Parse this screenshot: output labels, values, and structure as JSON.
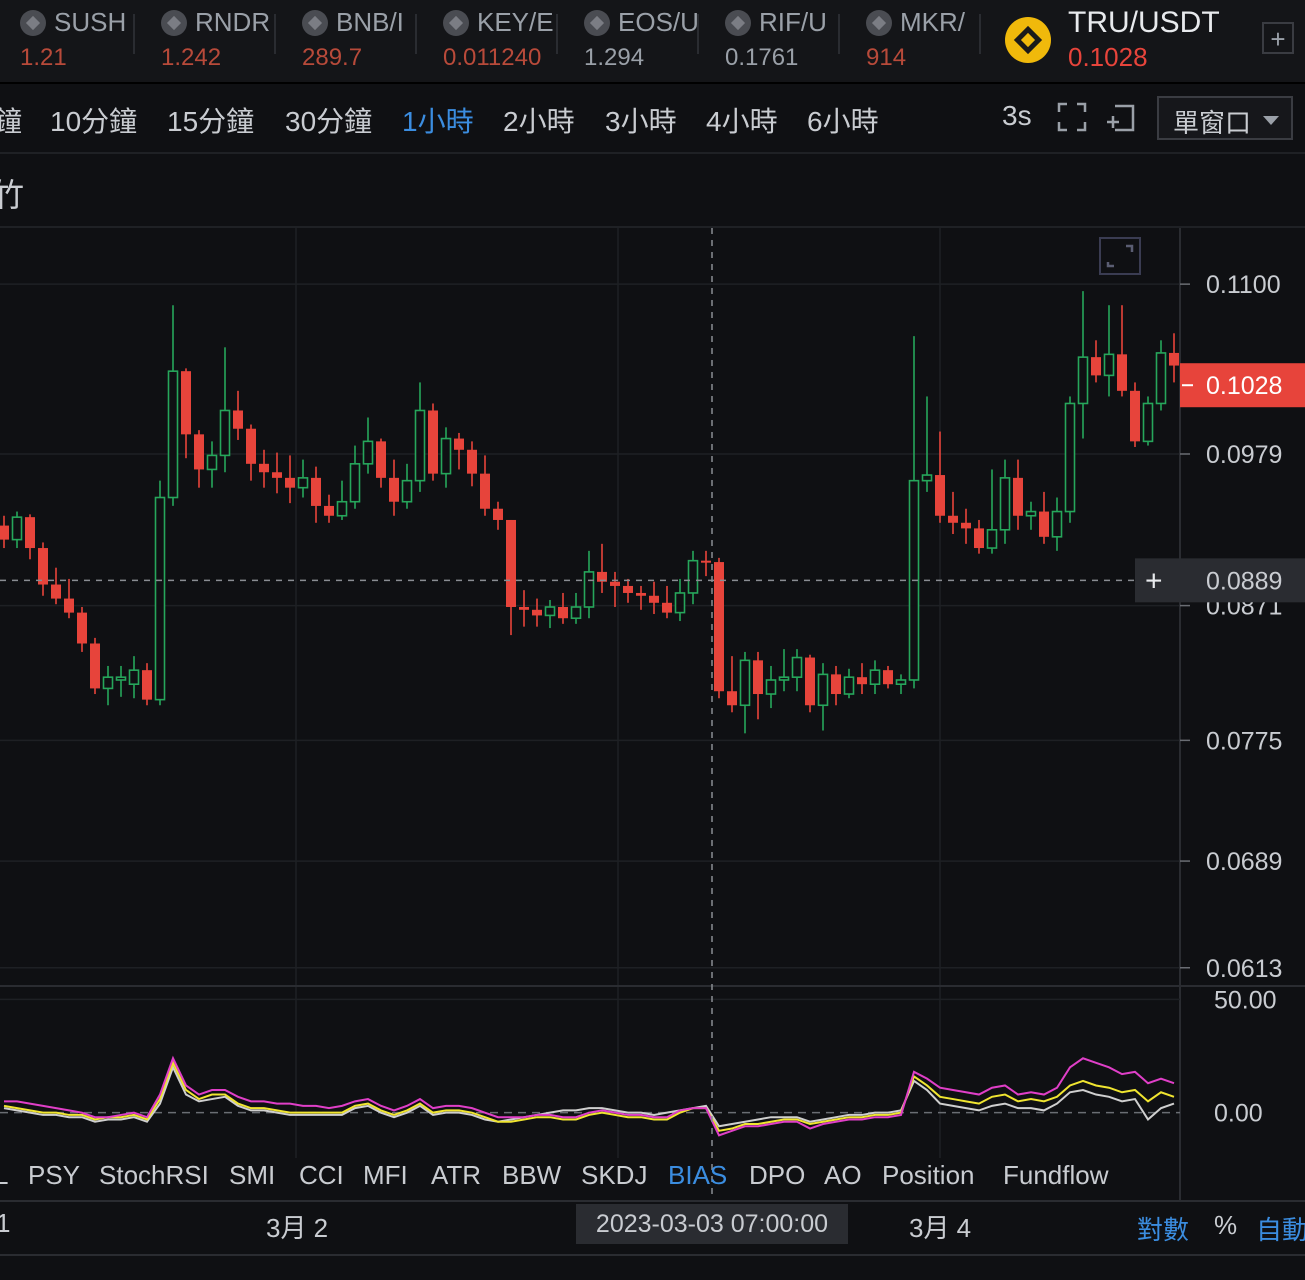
{
  "tickers": [
    {
      "symbol": "SUSH",
      "price": "1.21",
      "color": "#b84a3a"
    },
    {
      "symbol": "RNDR",
      "price": "1.242",
      "color": "#b84a3a"
    },
    {
      "symbol": "BNB/I",
      "price": "289.7",
      "color": "#b84a3a"
    },
    {
      "symbol": "KEY/E",
      "price": "0.011240",
      "color": "#b84a3a"
    },
    {
      "symbol": "EOS/U",
      "price": "1.294",
      "color": "#9aa0a8"
    },
    {
      "symbol": "RIF/U",
      "price": "0.1761",
      "color": "#9aa0a8"
    },
    {
      "symbol": "MKR/",
      "price": "914",
      "color": "#b84a3a"
    }
  ],
  "active_pair": {
    "symbol": "TRU/USDT",
    "price": "0.1028",
    "icon": "binance-coin-icon"
  },
  "add_tab_label": "+",
  "intervals": {
    "i5m": "鐘",
    "i10m": "10分鐘",
    "i15m": "15分鐘",
    "i30m": "30分鐘",
    "i1h": "1小時",
    "i2h": "2小時",
    "i3h": "3小時",
    "i4h": "4小時",
    "i6h": "6小時",
    "refresh": "3s",
    "layout_select": "單窗口"
  },
  "toolbar": {
    "partial_label": "竹"
  },
  "price_axis": {
    "ticks": [
      "0.1100",
      "0.0979",
      "0.0871",
      "0.0775",
      "0.0689",
      "0.0613"
    ],
    "current_price": "0.1028",
    "crosshair_price": "0.0889"
  },
  "indicator_axis": {
    "ticks": [
      "50.00",
      "0.00"
    ]
  },
  "indicator_tabs": [
    "L",
    "PSY",
    "StochRSI",
    "SMI",
    "CCI",
    "MFI",
    "ATR",
    "BBW",
    "SKDJ",
    "BIAS",
    "DPO",
    "AO",
    "Position",
    "Fundflow"
  ],
  "active_indicator": "BIAS",
  "time_axis": {
    "labels": [
      "1",
      "3月 2",
      "3月 4"
    ],
    "crosshair_time": "2023-03-03 07:00:00"
  },
  "scale_options": {
    "log": "對數",
    "percent": "%",
    "auto": "自動"
  },
  "colors": {
    "up": "#26a65b",
    "down": "#e7443b",
    "accent": "#3b8de0",
    "bias1": "#e03fc8",
    "bias2": "#f0e530",
    "bias3": "#cfcfcf"
  },
  "chart_data": {
    "type": "candlestick",
    "pair": "TRU/USDT",
    "interval": "1小時",
    "candles": [
      [
        0.0928,
        0.0935,
        0.0912,
        0.0918
      ],
      [
        0.0918,
        0.0938,
        0.0912,
        0.0934
      ],
      [
        0.0934,
        0.0936,
        0.0904,
        0.0912
      ],
      [
        0.0912,
        0.0916,
        0.0878,
        0.0886
      ],
      [
        0.0886,
        0.0898,
        0.0872,
        0.0876
      ],
      [
        0.0876,
        0.089,
        0.0862,
        0.0866
      ],
      [
        0.0866,
        0.087,
        0.0838,
        0.0844
      ],
      [
        0.0844,
        0.0848,
        0.0808,
        0.0812
      ],
      [
        0.0812,
        0.0828,
        0.08,
        0.082
      ],
      [
        0.0818,
        0.0828,
        0.0806,
        0.082
      ],
      [
        0.0815,
        0.0835,
        0.0805,
        0.0825
      ],
      [
        0.0825,
        0.083,
        0.08,
        0.0804
      ],
      [
        0.0804,
        0.096,
        0.08,
        0.0948
      ],
      [
        0.0948,
        0.1085,
        0.0942,
        0.1038
      ],
      [
        0.1038,
        0.104,
        0.0976,
        0.0993
      ],
      [
        0.0993,
        0.0996,
        0.0955,
        0.0968
      ],
      [
        0.0968,
        0.0988,
        0.0955,
        0.0978
      ],
      [
        0.0978,
        0.1055,
        0.0966,
        0.101
      ],
      [
        0.101,
        0.1024,
        0.0989,
        0.0997
      ],
      [
        0.0997,
        0.1,
        0.096,
        0.0972
      ],
      [
        0.0972,
        0.0982,
        0.0955,
        0.0966
      ],
      [
        0.0966,
        0.098,
        0.0951,
        0.0962
      ],
      [
        0.0962,
        0.0978,
        0.0944,
        0.0955
      ],
      [
        0.0955,
        0.0975,
        0.0948,
        0.0962
      ],
      [
        0.0962,
        0.097,
        0.093,
        0.0942
      ],
      [
        0.0942,
        0.095,
        0.093,
        0.0935
      ],
      [
        0.0935,
        0.096,
        0.0932,
        0.0945
      ],
      [
        0.0945,
        0.0985,
        0.094,
        0.0972
      ],
      [
        0.0972,
        0.1005,
        0.0965,
        0.0988
      ],
      [
        0.0988,
        0.099,
        0.0955,
        0.0962
      ],
      [
        0.0962,
        0.0975,
        0.0935,
        0.0945
      ],
      [
        0.0945,
        0.0972,
        0.094,
        0.096
      ],
      [
        0.096,
        0.103,
        0.0952,
        0.101
      ],
      [
        0.101,
        0.1015,
        0.096,
        0.0965
      ],
      [
        0.0965,
        0.0998,
        0.0955,
        0.099
      ],
      [
        0.099,
        0.0994,
        0.0968,
        0.0982
      ],
      [
        0.0982,
        0.0988,
        0.0956,
        0.0965
      ],
      [
        0.0965,
        0.0978,
        0.0935,
        0.094
      ],
      [
        0.094,
        0.0945,
        0.0925,
        0.0932
      ],
      [
        0.0932,
        0.0932,
        0.085,
        0.087
      ],
      [
        0.087,
        0.0882,
        0.0856,
        0.0868
      ],
      [
        0.0868,
        0.0876,
        0.0856,
        0.0864
      ],
      [
        0.0864,
        0.0875,
        0.0855,
        0.087
      ],
      [
        0.087,
        0.088,
        0.0858,
        0.0862
      ],
      [
        0.0862,
        0.088,
        0.0858,
        0.087
      ],
      [
        0.087,
        0.091,
        0.0862,
        0.0895
      ],
      [
        0.0895,
        0.0915,
        0.088,
        0.0888
      ],
      [
        0.0888,
        0.0895,
        0.087,
        0.0885
      ],
      [
        0.0885,
        0.089,
        0.0873,
        0.088
      ],
      [
        0.088,
        0.0885,
        0.0868,
        0.0878
      ],
      [
        0.0878,
        0.0888,
        0.0865,
        0.0873
      ],
      [
        0.0873,
        0.0885,
        0.0862,
        0.0866
      ],
      [
        0.0866,
        0.089,
        0.086,
        0.088
      ],
      [
        0.088,
        0.091,
        0.0872,
        0.0903
      ],
      [
        0.0903,
        0.091,
        0.0892,
        0.0902
      ],
      [
        0.0902,
        0.0905,
        0.0805,
        0.081
      ],
      [
        0.081,
        0.0835,
        0.0795,
        0.08
      ],
      [
        0.08,
        0.0838,
        0.078,
        0.0832
      ],
      [
        0.0832,
        0.0838,
        0.079,
        0.0808
      ],
      [
        0.0808,
        0.0828,
        0.0798,
        0.0818
      ],
      [
        0.0818,
        0.084,
        0.081,
        0.082
      ],
      [
        0.082,
        0.084,
        0.081,
        0.0834
      ],
      [
        0.0834,
        0.0836,
        0.0795,
        0.08
      ],
      [
        0.08,
        0.083,
        0.0782,
        0.0822
      ],
      [
        0.0822,
        0.0828,
        0.08,
        0.0808
      ],
      [
        0.0808,
        0.0826,
        0.0805,
        0.082
      ],
      [
        0.082,
        0.083,
        0.0808,
        0.0815
      ],
      [
        0.0815,
        0.0832,
        0.0808,
        0.0825
      ],
      [
        0.0825,
        0.0828,
        0.0812,
        0.0815
      ],
      [
        0.0815,
        0.0822,
        0.0808,
        0.0818
      ],
      [
        0.0818,
        0.1063,
        0.0812,
        0.096
      ],
      [
        0.096,
        0.102,
        0.0952,
        0.0964
      ],
      [
        0.0964,
        0.0995,
        0.093,
        0.0935
      ],
      [
        0.0935,
        0.0952,
        0.0922,
        0.093
      ],
      [
        0.093,
        0.094,
        0.0915,
        0.0926
      ],
      [
        0.0926,
        0.0932,
        0.0908,
        0.0912
      ],
      [
        0.0912,
        0.0968,
        0.0908,
        0.0925
      ],
      [
        0.0925,
        0.0975,
        0.0915,
        0.0962
      ],
      [
        0.0962,
        0.0975,
        0.0925,
        0.0935
      ],
      [
        0.0935,
        0.0945,
        0.0925,
        0.0938
      ],
      [
        0.0938,
        0.0952,
        0.0915,
        0.092
      ],
      [
        0.092,
        0.0948,
        0.091,
        0.0938
      ],
      [
        0.0938,
        0.102,
        0.093,
        0.1015
      ],
      [
        0.1015,
        0.1095,
        0.099,
        0.1048
      ],
      [
        0.1048,
        0.106,
        0.103,
        0.1035
      ],
      [
        0.1035,
        0.1085,
        0.102,
        0.105
      ],
      [
        0.105,
        0.1085,
        0.102,
        0.1024
      ],
      [
        0.1024,
        0.103,
        0.0984,
        0.0988
      ],
      [
        0.0988,
        0.102,
        0.0985,
        0.1015
      ],
      [
        0.1015,
        0.106,
        0.101,
        0.1051
      ],
      [
        0.1051,
        0.1065,
        0.103,
        0.1042
      ]
    ],
    "bias": {
      "bias1": [
        5,
        5,
        4,
        3,
        2,
        1,
        0,
        -2,
        -2,
        -1,
        0,
        -2,
        8,
        24,
        12,
        8,
        10,
        10,
        7,
        5,
        5,
        4,
        4,
        3,
        3,
        2,
        3,
        5,
        6,
        3,
        1,
        3,
        6,
        2,
        3,
        3,
        2,
        0,
        -2,
        -2,
        -2,
        -1,
        -1,
        -2,
        -2,
        0,
        1,
        0,
        -1,
        -1,
        -2,
        -2,
        1,
        2,
        2,
        -10,
        -8,
        -6,
        -6,
        -5,
        -4,
        -4,
        -7,
        -5,
        -4,
        -3,
        -3,
        -2,
        -2,
        -1,
        18,
        15,
        11,
        10,
        9,
        8,
        11,
        12,
        8,
        9,
        8,
        11,
        20,
        24,
        22,
        20,
        17,
        18,
        13,
        15,
        13
      ],
      "bias2": [
        3,
        2,
        1,
        0,
        0,
        -1,
        -1,
        -3,
        -2,
        -2,
        -1,
        -3,
        6,
        22,
        10,
        6,
        8,
        8,
        4,
        2,
        2,
        1,
        0,
        0,
        0,
        0,
        0,
        3,
        4,
        1,
        -1,
        1,
        4,
        0,
        1,
        1,
        0,
        -2,
        -4,
        -4,
        -3,
        -2,
        -2,
        -3,
        -3,
        -1,
        0,
        -1,
        -2,
        -2,
        -3,
        -3,
        0,
        2,
        2,
        -8,
        -7,
        -5,
        -5,
        -4,
        -3,
        -3,
        -5,
        -4,
        -3,
        -2,
        -2,
        -1,
        -1,
        0,
        16,
        12,
        7,
        6,
        5,
        4,
        7,
        8,
        5,
        6,
        5,
        7,
        12,
        14,
        12,
        11,
        9,
        10,
        5,
        9,
        7
      ],
      "bias3": [
        2,
        1,
        0,
        -1,
        -1,
        -2,
        -2,
        -4,
        -3,
        -3,
        -2,
        -4,
        4,
        20,
        8,
        5,
        6,
        7,
        3,
        1,
        1,
        0,
        -1,
        -1,
        -1,
        -1,
        -1,
        2,
        3,
        0,
        -2,
        0,
        3,
        -1,
        0,
        0,
        -1,
        -3,
        -4,
        -3,
        -2,
        -1,
        0,
        1,
        1,
        2,
        2,
        1,
        0,
        0,
        -1,
        0,
        1,
        2,
        3,
        -6,
        -5,
        -4,
        -3,
        -2,
        -2,
        -2,
        -4,
        -3,
        -2,
        -1,
        -1,
        0,
        0,
        1,
        14,
        10,
        4,
        3,
        2,
        1,
        3,
        4,
        2,
        2,
        1,
        4,
        9,
        10,
        8,
        7,
        5,
        6,
        -3,
        2,
        4
      ]
    },
    "price_ylim": [
      0.06,
      0.114
    ],
    "bias_ylim": [
      -20,
      55
    ]
  }
}
